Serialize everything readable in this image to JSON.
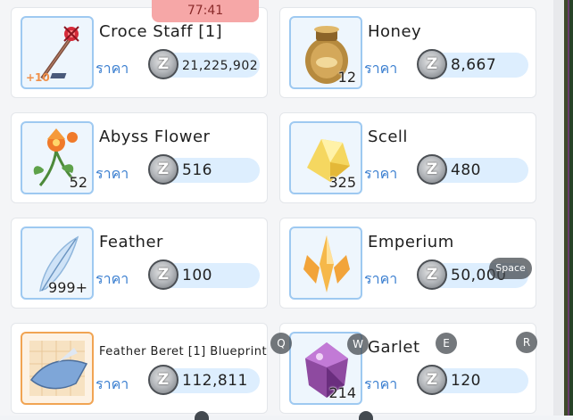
{
  "timer": "77:41",
  "price_label": "ราคา",
  "currency_symbol": "Z",
  "items": [
    {
      "name": "Croce Staff [1]",
      "price": "21,225,902",
      "qty": "",
      "refine": "+10",
      "icon": "staff-icon"
    },
    {
      "name": "Honey",
      "price": "8,667",
      "qty": "12",
      "icon": "honey-jar-icon"
    },
    {
      "name": "Abyss Flower",
      "price": "516",
      "qty": "52",
      "icon": "flower-icon"
    },
    {
      "name": "Scell",
      "price": "480",
      "qty": "325",
      "icon": "scell-crystal-icon"
    },
    {
      "name": "Feather",
      "price": "100",
      "qty": "999+",
      "icon": "feather-icon"
    },
    {
      "name": "Emperium",
      "price": "50,000",
      "qty": "",
      "icon": "emperium-icon"
    },
    {
      "name": "Feather Beret [1] Blueprint",
      "price": "112,811",
      "qty": "",
      "icon": "blueprint-icon"
    },
    {
      "name": "Garlet",
      "price": "120",
      "qty": "214",
      "icon": "garlet-gem-icon"
    }
  ],
  "hotkeys": {
    "q": "Q",
    "w": "W",
    "e": "E",
    "r": "R",
    "space": "Space"
  },
  "colors": {
    "price_label": "#3b7fd0",
    "timer_bg": "#f6a7a7",
    "icon_border": "#9ec9f1",
    "blueprint_border": "#f1a453"
  }
}
